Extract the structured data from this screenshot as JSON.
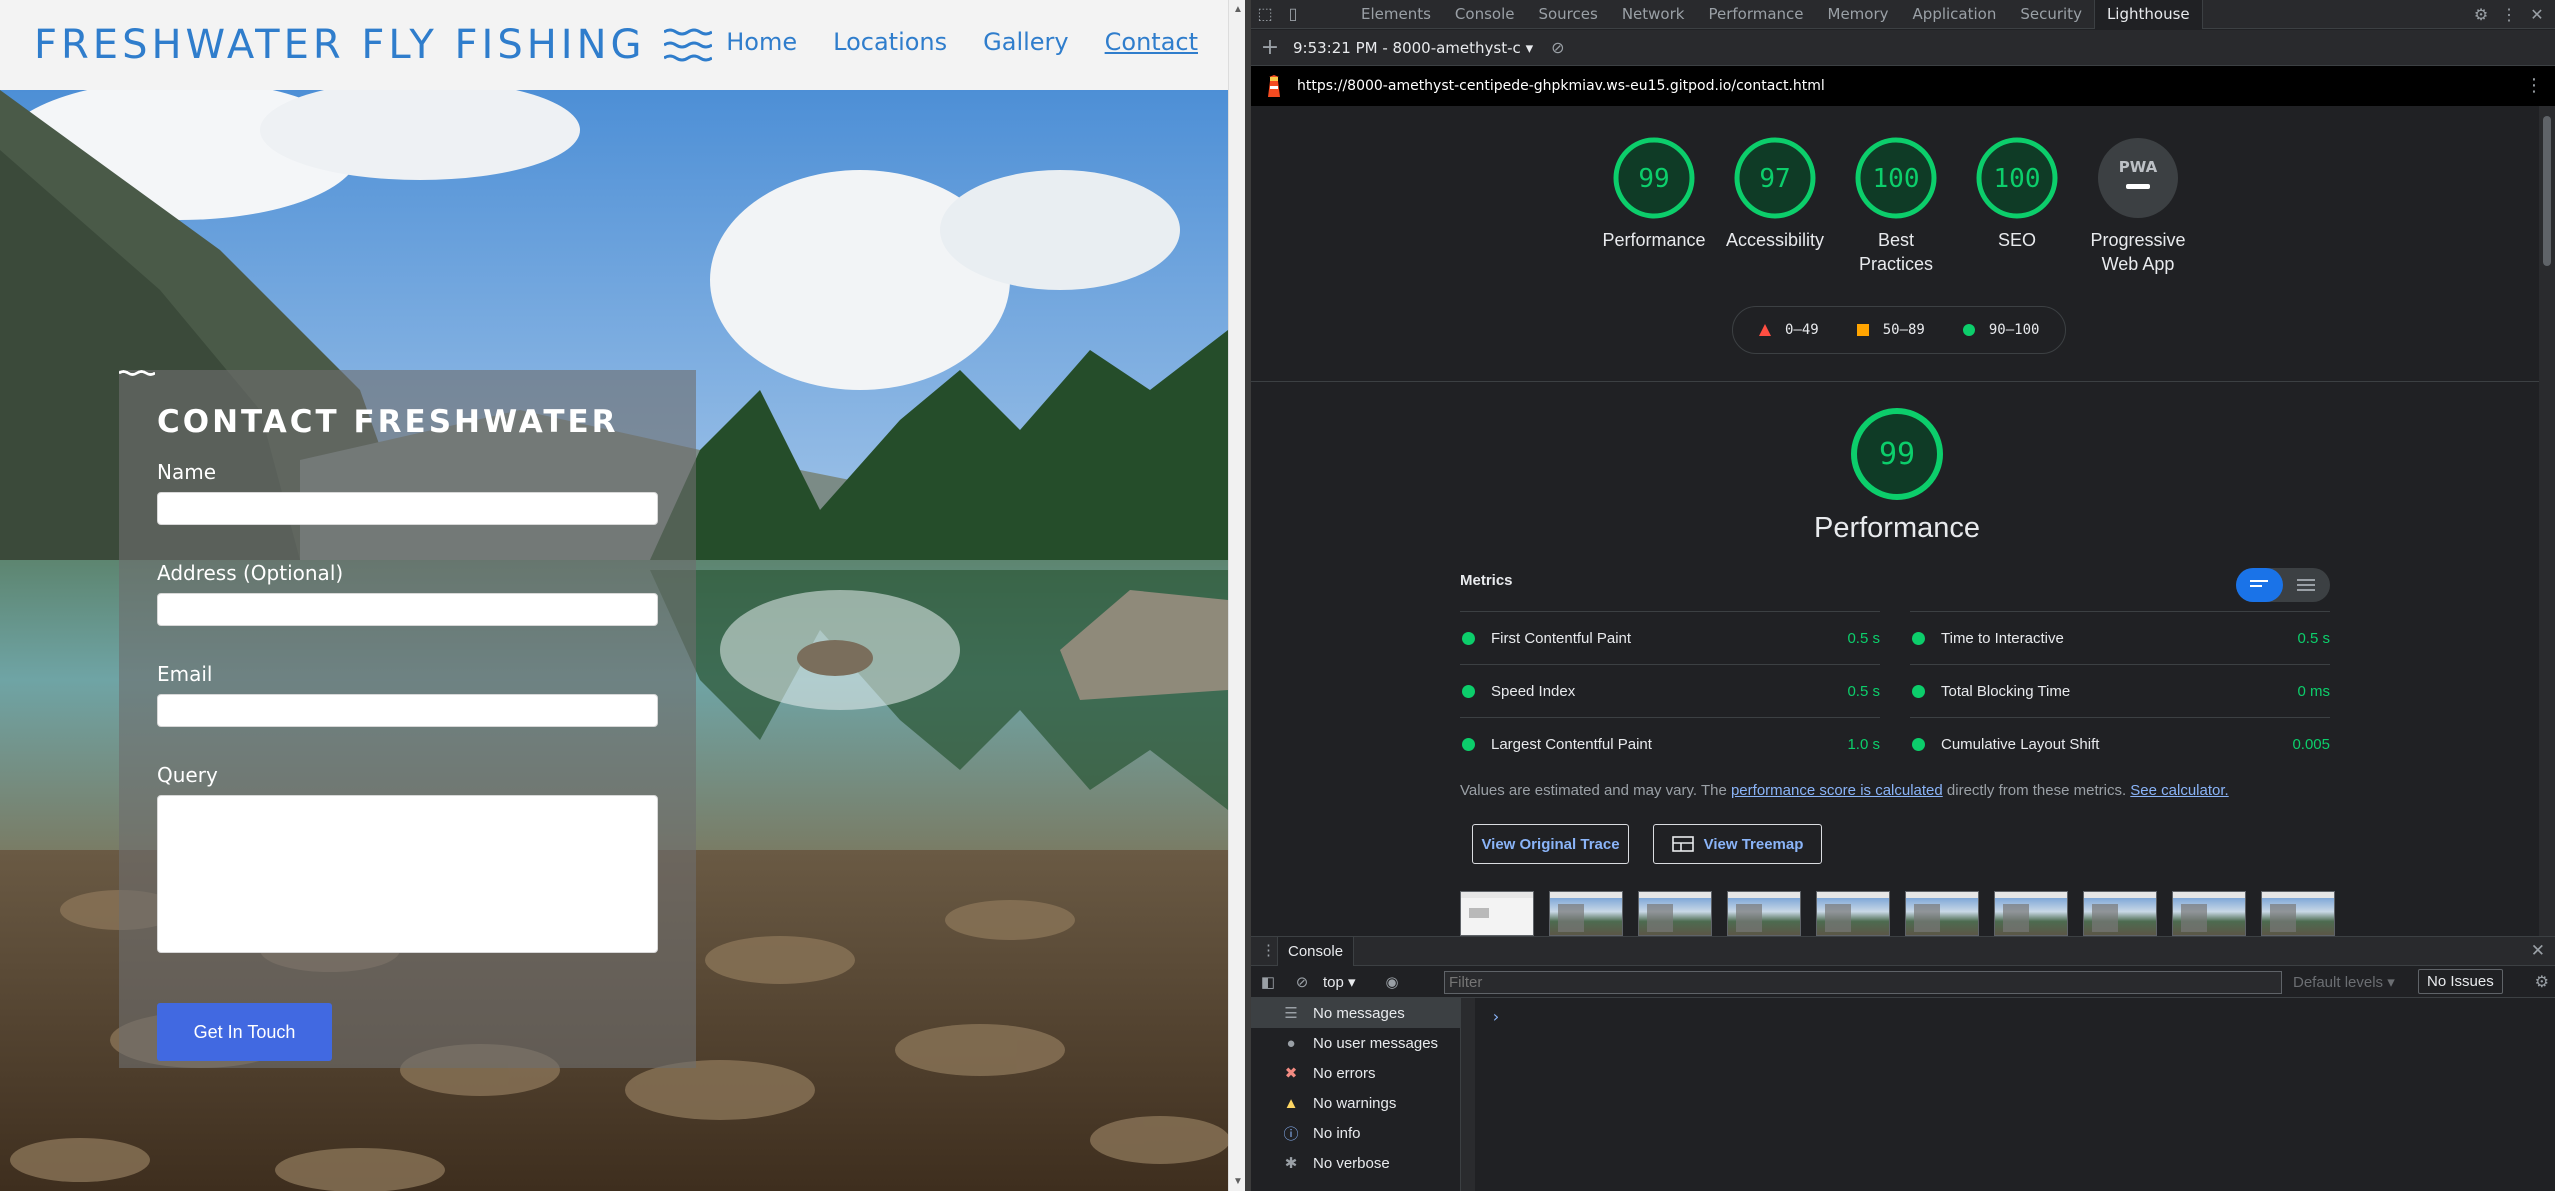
{
  "site": {
    "brand": "FRESHWATER FLY FISHING",
    "nav": [
      "Home",
      "Locations",
      "Gallery",
      "Contact"
    ],
    "active_nav": "Contact",
    "contact": {
      "title": "CONTACT FRESHWATER",
      "name_label": "Name",
      "address_label": "Address (Optional)",
      "email_label": "Email",
      "query_label": "Query",
      "submit_label": "Get In Touch"
    },
    "colors": {
      "brand": "#2f7dcc",
      "button": "#4169e1"
    }
  },
  "devtools": {
    "tabs": [
      "Elements",
      "Console",
      "Sources",
      "Network",
      "Performance",
      "Memory",
      "Application",
      "Security",
      "Lighthouse"
    ],
    "active_tab": "Lighthouse",
    "report_selector": "9:53:21 PM - 8000-amethyst-c",
    "url": "https://8000-amethyst-centipede-ghpkmiav.ws-eu15.gitpod.io/contact.html",
    "gauges": [
      {
        "score": "99",
        "label": "Performance"
      },
      {
        "score": "97",
        "label": "Accessibility"
      },
      {
        "score": "100",
        "label": "Best Practices"
      },
      {
        "score": "100",
        "label": "SEO"
      }
    ],
    "pwa": {
      "badge": "PWA",
      "label": "Progressive Web App"
    },
    "legend": [
      "0–49",
      "50–89",
      "90–100"
    ],
    "performance": {
      "score": "99",
      "title": "Performance",
      "metrics_heading": "Metrics",
      "metrics": [
        {
          "name": "First Contentful Paint",
          "value": "0.5 s"
        },
        {
          "name": "Time to Interactive",
          "value": "0.5 s"
        },
        {
          "name": "Speed Index",
          "value": "0.5 s"
        },
        {
          "name": "Total Blocking Time",
          "value": "0 ms"
        },
        {
          "name": "Largest Contentful Paint",
          "value": "1.0 s"
        },
        {
          "name": "Cumulative Layout Shift",
          "value": "0.005"
        }
      ],
      "note_prefix": "Values are estimated and may vary. The ",
      "note_link1": "performance score is calculated",
      "note_middle": " directly from these metrics. ",
      "note_link2": "See calculator.",
      "btn_trace": "View Original Trace",
      "btn_treemap": "View Treemap"
    },
    "colors": {
      "pass": "#0cce6b",
      "average": "#ffa400",
      "fail": "#ff4e42",
      "link": "#8ab4f8"
    },
    "console": {
      "tab": "Console",
      "context": "top",
      "filter_placeholder": "Filter",
      "levels": "Default levels",
      "issues": "No Issues",
      "sidebar": [
        {
          "label": "No messages",
          "icon": "list-icon"
        },
        {
          "label": "No user messages",
          "icon": "user-icon"
        },
        {
          "label": "No errors",
          "icon": "error-icon"
        },
        {
          "label": "No warnings",
          "icon": "warning-icon"
        },
        {
          "label": "No info",
          "icon": "info-icon"
        },
        {
          "label": "No verbose",
          "icon": "bug-icon"
        }
      ]
    }
  }
}
